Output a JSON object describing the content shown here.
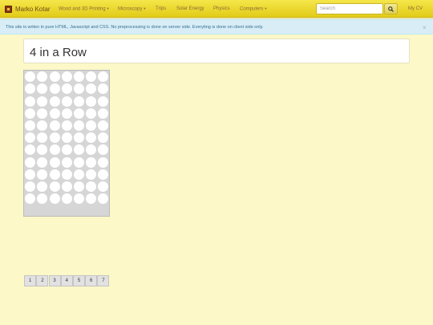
{
  "navbar": {
    "brand": "Marko Kotar",
    "items": [
      {
        "label": "Wood and 3D Printing",
        "dropdown": true
      },
      {
        "label": "Microscopy",
        "dropdown": true
      },
      {
        "label": "Trips",
        "dropdown": false
      },
      {
        "label": "Solar Energy",
        "dropdown": false
      },
      {
        "label": "Physics",
        "dropdown": false
      },
      {
        "label": "Computers",
        "dropdown": true
      }
    ],
    "search_placeholder": "Search",
    "search_icon": "search-icon",
    "my_cv": "My CV"
  },
  "alert": {
    "text": "This site is writen in pure HTML, Javascript and CSS. No preprocessing is done on server side. Everyting is done on client side only.",
    "close": "×"
  },
  "page": {
    "title": "4 in a Row"
  },
  "game": {
    "columns": [
      "1",
      "2",
      "3",
      "4",
      "5",
      "6",
      "7"
    ],
    "rows": 11,
    "board_state": "empty"
  },
  "colors": {
    "navbar": "#e9d72a",
    "background": "#fcf8c8",
    "alert": "#d9edf7",
    "alert_text": "#31708f",
    "board": "#d6d6d6",
    "empty_cell": "#ffffff"
  }
}
